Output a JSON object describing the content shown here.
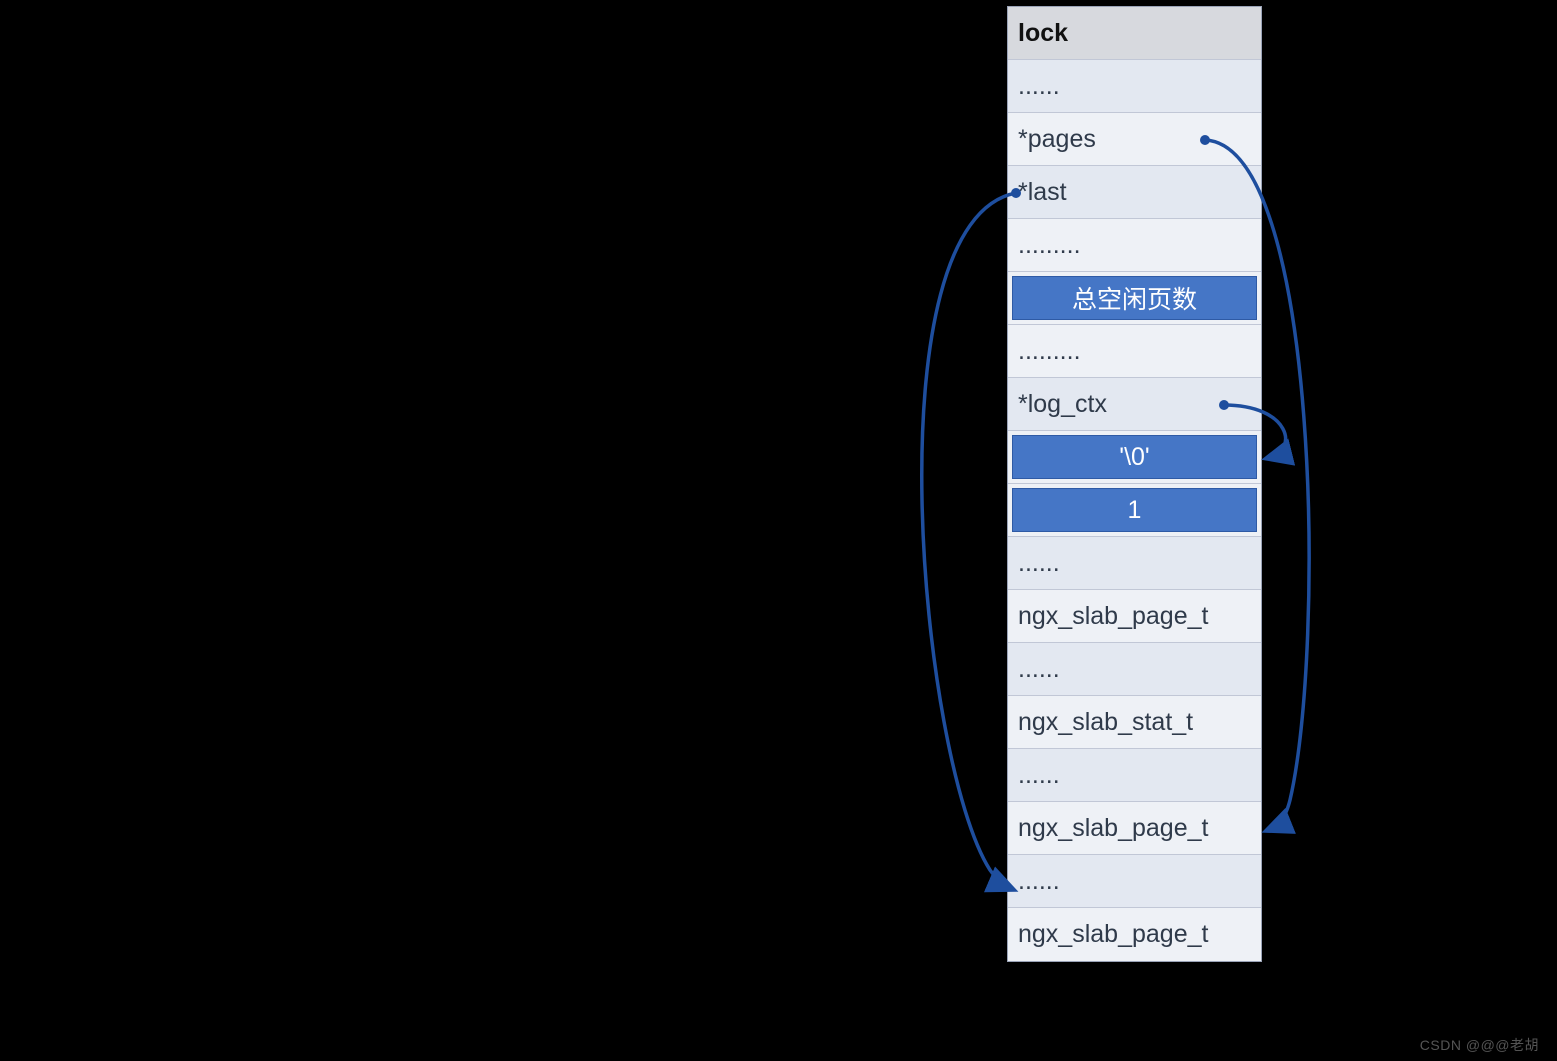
{
  "rows": [
    {
      "text": "lock",
      "style": "header"
    },
    {
      "text": "......",
      "style": "light"
    },
    {
      "text": "*pages",
      "style": "lighter"
    },
    {
      "text": "*last",
      "style": "light"
    },
    {
      "text": ".........",
      "style": "lighter"
    },
    {
      "text": "总空闲页数",
      "style": "blue"
    },
    {
      "text": ".........",
      "style": "lighter"
    },
    {
      "text": "*log_ctx",
      "style": "light"
    },
    {
      "text": "'\\0'",
      "style": "blue"
    },
    {
      "text": "1",
      "style": "blue"
    },
    {
      "text": "......",
      "style": "light"
    },
    {
      "text": "ngx_slab_page_t",
      "style": "lighter"
    },
    {
      "text": "......",
      "style": "light"
    },
    {
      "text": "ngx_slab_stat_t",
      "style": "lighter"
    },
    {
      "text": "......",
      "style": "light"
    },
    {
      "text": "ngx_slab_page_t",
      "style": "lighter"
    },
    {
      "text": "......",
      "style": "light"
    },
    {
      "text": "ngx_slab_page_t",
      "style": "lighter"
    }
  ],
  "colors": {
    "arrow": "#1e4e9e"
  },
  "watermark": "CSDN @@@老胡"
}
